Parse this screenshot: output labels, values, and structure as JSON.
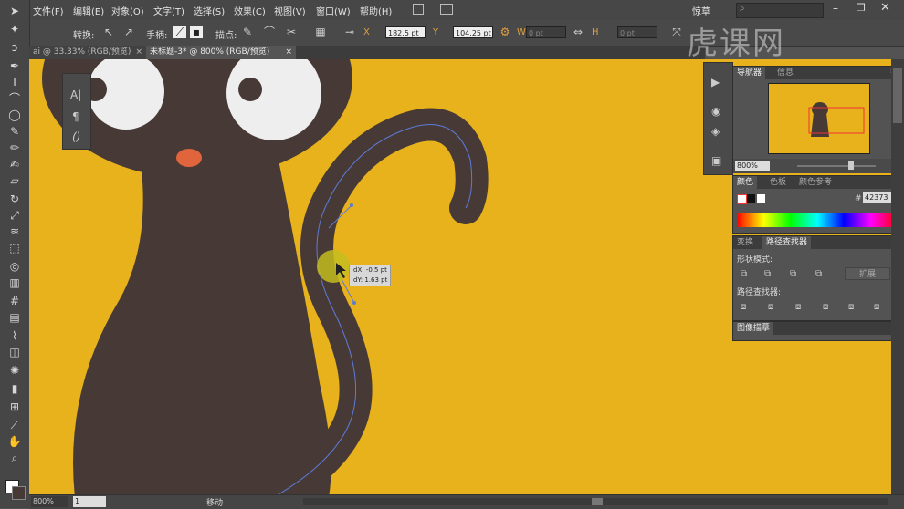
{
  "menu": {
    "items": [
      "文件(F)",
      "编辑(E)",
      "对象(O)",
      "文字(T)",
      "选择(S)",
      "效果(C)",
      "视图(V)",
      "窗口(W)",
      "帮助(H)"
    ],
    "workspace": "惊草"
  },
  "options": {
    "convert_label": "转换:",
    "handles_label": "手柄:",
    "anchors_label": "描点:",
    "x_value": "182.5 pt",
    "y_value": "104.25 pt",
    "w_value": "0 pt",
    "h_value": "0 pt"
  },
  "tabs": [
    {
      "label": "ai @ 33.33% (RGB/预览)",
      "active": false
    },
    {
      "label": "未标题-3* @ 800% (RGB/预览)",
      "active": true
    }
  ],
  "watermark": "虎课网",
  "tooltip": {
    "dx": "dX: -0.5 pt",
    "dy": "dY: 1.63 pt"
  },
  "navigator": {
    "tabs": [
      "导航器",
      "信息"
    ],
    "zoom": "800%"
  },
  "color_panel": {
    "tabs": [
      "颜色",
      "色板",
      "颜色参考"
    ],
    "hex": "42373"
  },
  "pathfinder": {
    "tabs": [
      "变换",
      "路径查找器"
    ],
    "shape_modes": "形状模式:",
    "expand": "扩展",
    "pathfinders": "路径查找器:"
  },
  "image_trace": "图像描摹",
  "status": {
    "zoom": "800%",
    "page": "1",
    "mode": "移动"
  },
  "colors": {
    "canvas_bg": "#E8B21C",
    "cat_body": "#473A36",
    "eye_white": "#EEEEEE",
    "nose": "#E0643C",
    "path_highlight": "#5C7BD8"
  }
}
